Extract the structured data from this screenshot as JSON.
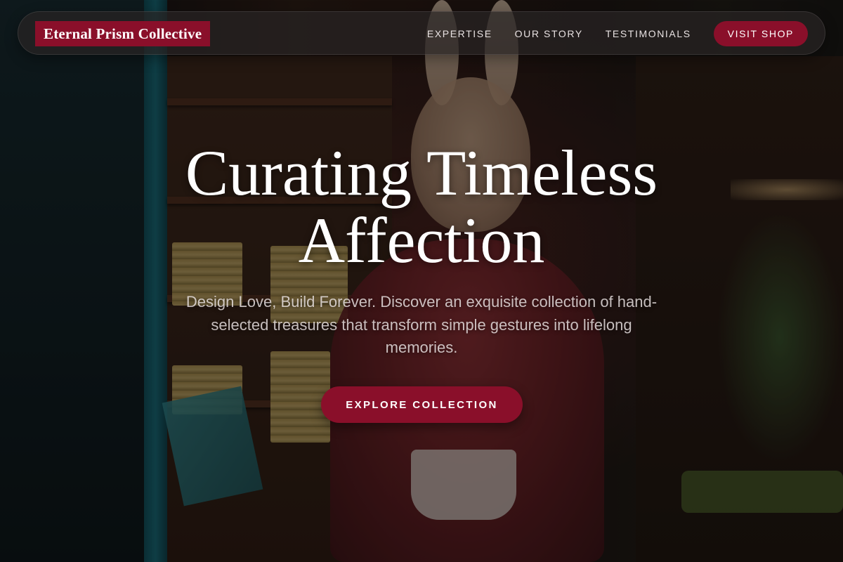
{
  "brand": {
    "name": "Eternal Prism Collective"
  },
  "nav": {
    "links": [
      {
        "label": "EXPERTISE"
      },
      {
        "label": "OUR STORY"
      },
      {
        "label": "TESTIMONIALS"
      }
    ],
    "cta_label": "VISIT SHOP"
  },
  "hero": {
    "title": "Curating Timeless Affection",
    "subtitle": "Design Love, Build Forever. Discover an exquisite collection of hand-selected treasures that transform simple gestures into lifelong memories.",
    "cta_label": "EXPLORE COLLECTION"
  },
  "colors": {
    "accent": "#8a0f2a",
    "nav_background": "#282424",
    "text_light": "#ffffff"
  }
}
